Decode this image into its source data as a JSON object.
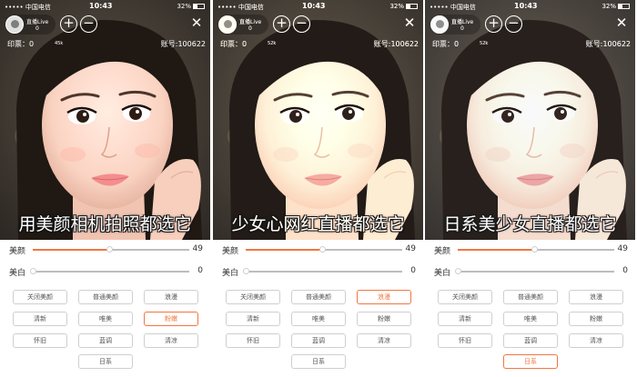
{
  "status_bar": {
    "carrier": "••••• 中国电信",
    "time": "10:43",
    "battery": "32%"
  },
  "host": {
    "name": "直播Live",
    "viewers": "0"
  },
  "tickets": "印票：0",
  "likes_count": [
    "45k",
    "52k",
    "52k"
  ],
  "room_id": "账号:100622",
  "icons": {
    "add": "add-circle-icon",
    "minus": "minus-circle-icon",
    "close": "close-icon",
    "wifi": "wifi-icon",
    "battery": "battery-icon"
  },
  "accent_color": "#f07642",
  "panels": [
    {
      "caption": "用美颜相机拍照都选它",
      "beauty": {
        "label": "美颜",
        "value": "49",
        "level": 0.49
      },
      "whitening": {
        "label": "美白",
        "value": "0",
        "level": 0
      },
      "filters": [
        "关闭美颜",
        "普通美颜",
        "浪漫",
        "清新",
        "唯美",
        "粉嫩",
        "怀旧",
        "蓝调",
        "清凉",
        "日系"
      ],
      "selected_filter": "粉嫩"
    },
    {
      "caption": "少女心网红直播都选它",
      "beauty": {
        "label": "美颜",
        "value": "49",
        "level": 0.49
      },
      "whitening": {
        "label": "美白",
        "value": "0",
        "level": 0
      },
      "filters": [
        "关闭美颜",
        "普通美颜",
        "浪漫",
        "清新",
        "唯美",
        "粉嫩",
        "怀旧",
        "蓝调",
        "清凉",
        "日系"
      ],
      "selected_filter": "浪漫"
    },
    {
      "caption": "日系美少女直播都选它",
      "beauty": {
        "label": "美颜",
        "value": "49",
        "level": 0.49
      },
      "whitening": {
        "label": "美白",
        "value": "0",
        "level": 0
      },
      "filters": [
        "关闭美颜",
        "普通美颜",
        "浪漫",
        "清新",
        "唯美",
        "粉嫩",
        "怀旧",
        "蓝调",
        "清凉",
        "日系"
      ],
      "selected_filter": "日系"
    }
  ]
}
